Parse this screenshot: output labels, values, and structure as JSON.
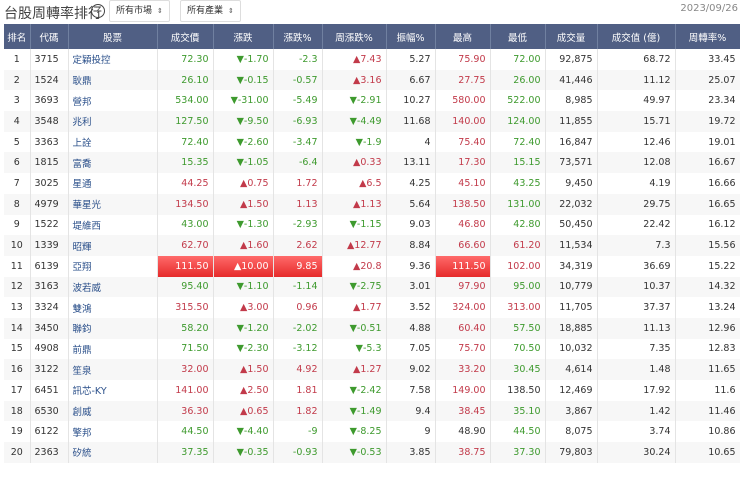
{
  "header": {
    "title": "台股周轉率排行",
    "help_icon": "?",
    "market_select": "所有市場",
    "industry_select": "所有產業",
    "date": "2023/09/26"
  },
  "columns": [
    "排名",
    "代碼",
    "股票",
    "成交價",
    "漲跌",
    "漲跌%",
    "周漲跌%",
    "振幅%",
    "最高",
    "最低",
    "成交量",
    "成交值 (億)",
    "周轉率%"
  ],
  "colors": {
    "up": "#c23a4a",
    "down": "#3e9a2e",
    "header_bg": "#505f84",
    "limit_up": "#e62a2a"
  },
  "rows": [
    {
      "rank": "1",
      "code": "3715",
      "name": "定穎投控",
      "price": "72.30",
      "chg": "▼-1.70",
      "pct": "-2.3",
      "dir": "d",
      "wk": "▲7.43",
      "wkdir": "u",
      "amp": "5.27",
      "high": "75.90",
      "hd": "u",
      "low": "72.00",
      "ld": "d",
      "vol": "92,875",
      "val": "68.72",
      "turn": "33.45"
    },
    {
      "rank": "2",
      "code": "1524",
      "name": "耿鼎",
      "price": "26.10",
      "chg": "▼-0.15",
      "pct": "-0.57",
      "dir": "d",
      "wk": "▲3.16",
      "wkdir": "u",
      "amp": "6.67",
      "high": "27.75",
      "hd": "u",
      "low": "26.00",
      "ld": "d",
      "vol": "41,446",
      "val": "11.12",
      "turn": "25.07"
    },
    {
      "rank": "3",
      "code": "3693",
      "name": "營邦",
      "price": "534.00",
      "chg": "▼-31.00",
      "pct": "-5.49",
      "dir": "d",
      "wk": "▼-2.91",
      "wkdir": "d",
      "amp": "10.27",
      "high": "580.00",
      "hd": "u",
      "low": "522.00",
      "ld": "d",
      "vol": "8,985",
      "val": "49.97",
      "turn": "23.34"
    },
    {
      "rank": "4",
      "code": "3548",
      "name": "兆利",
      "price": "127.50",
      "chg": "▼-9.50",
      "pct": "-6.93",
      "dir": "d",
      "wk": "▼-4.49",
      "wkdir": "d",
      "amp": "11.68",
      "high": "140.00",
      "hd": "u",
      "low": "124.00",
      "ld": "d",
      "vol": "11,855",
      "val": "15.71",
      "turn": "19.72"
    },
    {
      "rank": "5",
      "code": "3363",
      "name": "上詮",
      "price": "72.40",
      "chg": "▼-2.60",
      "pct": "-3.47",
      "dir": "d",
      "wk": "▼-1.9",
      "wkdir": "d",
      "amp": "4",
      "high": "75.40",
      "hd": "u",
      "low": "72.40",
      "ld": "d",
      "vol": "16,847",
      "val": "12.46",
      "turn": "19.01"
    },
    {
      "rank": "6",
      "code": "1815",
      "name": "富喬",
      "price": "15.35",
      "chg": "▼-1.05",
      "pct": "-6.4",
      "dir": "d",
      "wk": "▲0.33",
      "wkdir": "u",
      "amp": "13.11",
      "high": "17.30",
      "hd": "u",
      "low": "15.15",
      "ld": "d",
      "vol": "73,571",
      "val": "12.08",
      "turn": "16.67"
    },
    {
      "rank": "7",
      "code": "3025",
      "name": "星通",
      "price": "44.25",
      "chg": "▲0.75",
      "pct": "1.72",
      "dir": "u",
      "wk": "▲6.5",
      "wkdir": "u",
      "amp": "4.25",
      "high": "45.10",
      "hd": "u",
      "low": "43.25",
      "ld": "d",
      "vol": "9,450",
      "val": "4.19",
      "turn": "16.66"
    },
    {
      "rank": "8",
      "code": "4979",
      "name": "華星光",
      "price": "134.50",
      "chg": "▲1.50",
      "pct": "1.13",
      "dir": "u",
      "wk": "▲1.13",
      "wkdir": "u",
      "amp": "5.64",
      "high": "138.50",
      "hd": "u",
      "low": "131.00",
      "ld": "d",
      "vol": "22,032",
      "val": "29.75",
      "turn": "16.65"
    },
    {
      "rank": "9",
      "code": "1522",
      "name": "堤維西",
      "price": "43.00",
      "chg": "▼-1.30",
      "pct": "-2.93",
      "dir": "d",
      "wk": "▼-1.15",
      "wkdir": "d",
      "amp": "9.03",
      "high": "46.80",
      "hd": "u",
      "low": "42.80",
      "ld": "d",
      "vol": "50,450",
      "val": "22.42",
      "turn": "16.12"
    },
    {
      "rank": "10",
      "code": "1339",
      "name": "昭輝",
      "price": "62.70",
      "chg": "▲1.60",
      "pct": "2.62",
      "dir": "u",
      "wk": "▲12.77",
      "wkdir": "u",
      "amp": "8.84",
      "high": "66.60",
      "hd": "u",
      "low": "61.20",
      "ld": "u",
      "vol": "11,534",
      "val": "7.3",
      "turn": "15.56"
    },
    {
      "rank": "11",
      "code": "6139",
      "name": "亞翔",
      "price": "111.50",
      "chg": "▲10.00",
      "pct": "9.85",
      "dir": "u",
      "limit": true,
      "wk": "▲20.8",
      "wkdir": "u",
      "amp": "9.36",
      "high": "111.50",
      "hd": "u",
      "low": "102.00",
      "ld": "u",
      "vol": "34,319",
      "val": "36.69",
      "turn": "15.22"
    },
    {
      "rank": "12",
      "code": "3163",
      "name": "波若威",
      "price": "95.40",
      "chg": "▼-1.10",
      "pct": "-1.14",
      "dir": "d",
      "wk": "▼-2.75",
      "wkdir": "d",
      "amp": "3.01",
      "high": "97.90",
      "hd": "u",
      "low": "95.00",
      "ld": "d",
      "vol": "10,779",
      "val": "10.37",
      "turn": "14.32"
    },
    {
      "rank": "13",
      "code": "3324",
      "name": "雙鴻",
      "price": "315.50",
      "chg": "▲3.00",
      "pct": "0.96",
      "dir": "u",
      "wk": "▲1.77",
      "wkdir": "u",
      "amp": "3.52",
      "high": "324.00",
      "hd": "u",
      "low": "313.00",
      "ld": "u",
      "vol": "11,705",
      "val": "37.37",
      "turn": "13.24"
    },
    {
      "rank": "14",
      "code": "3450",
      "name": "聯鈞",
      "price": "58.20",
      "chg": "▼-1.20",
      "pct": "-2.02",
      "dir": "d",
      "wk": "▼-0.51",
      "wkdir": "d",
      "amp": "4.88",
      "high": "60.40",
      "hd": "u",
      "low": "57.50",
      "ld": "d",
      "vol": "18,885",
      "val": "11.13",
      "turn": "12.96"
    },
    {
      "rank": "15",
      "code": "4908",
      "name": "前鼎",
      "price": "71.50",
      "chg": "▼-2.30",
      "pct": "-3.12",
      "dir": "d",
      "wk": "▼-5.3",
      "wkdir": "d",
      "amp": "7.05",
      "high": "75.70",
      "hd": "u",
      "low": "70.50",
      "ld": "d",
      "vol": "10,032",
      "val": "7.35",
      "turn": "12.83"
    },
    {
      "rank": "16",
      "code": "3122",
      "name": "笙泉",
      "price": "32.00",
      "chg": "▲1.50",
      "pct": "4.92",
      "dir": "u",
      "wk": "▲1.27",
      "wkdir": "u",
      "amp": "9.02",
      "high": "33.20",
      "hd": "u",
      "low": "30.45",
      "ld": "d",
      "vol": "4,614",
      "val": "1.48",
      "turn": "11.65"
    },
    {
      "rank": "17",
      "code": "6451",
      "name": "訊芯-KY",
      "price": "141.00",
      "chg": "▲2.50",
      "pct": "1.81",
      "dir": "u",
      "wk": "▼-2.42",
      "wkdir": "d",
      "amp": "7.58",
      "high": "149.00",
      "hd": "u",
      "low": "138.50",
      "ld": "n",
      "vol": "12,469",
      "val": "17.92",
      "turn": "11.6"
    },
    {
      "rank": "18",
      "code": "6530",
      "name": "創威",
      "price": "36.30",
      "chg": "▲0.65",
      "pct": "1.82",
      "dir": "u",
      "wk": "▼-1.49",
      "wkdir": "d",
      "amp": "9.4",
      "high": "38.45",
      "hd": "u",
      "low": "35.10",
      "ld": "d",
      "vol": "3,867",
      "val": "1.42",
      "turn": "11.46"
    },
    {
      "rank": "19",
      "code": "6122",
      "name": "擎邦",
      "price": "44.50",
      "chg": "▼-4.40",
      "pct": "-9",
      "dir": "d",
      "wk": "▼-8.25",
      "wkdir": "d",
      "amp": "9",
      "high": "48.90",
      "hd": "n",
      "low": "44.50",
      "ld": "d",
      "vol": "8,075",
      "val": "3.74",
      "turn": "10.86"
    },
    {
      "rank": "20",
      "code": "2363",
      "name": "矽統",
      "price": "37.35",
      "chg": "▼-0.35",
      "pct": "-0.93",
      "dir": "d",
      "wk": "▼-0.53",
      "wkdir": "d",
      "amp": "3.85",
      "high": "38.75",
      "hd": "u",
      "low": "37.30",
      "ld": "d",
      "vol": "79,803",
      "val": "30.24",
      "turn": "10.65"
    }
  ]
}
